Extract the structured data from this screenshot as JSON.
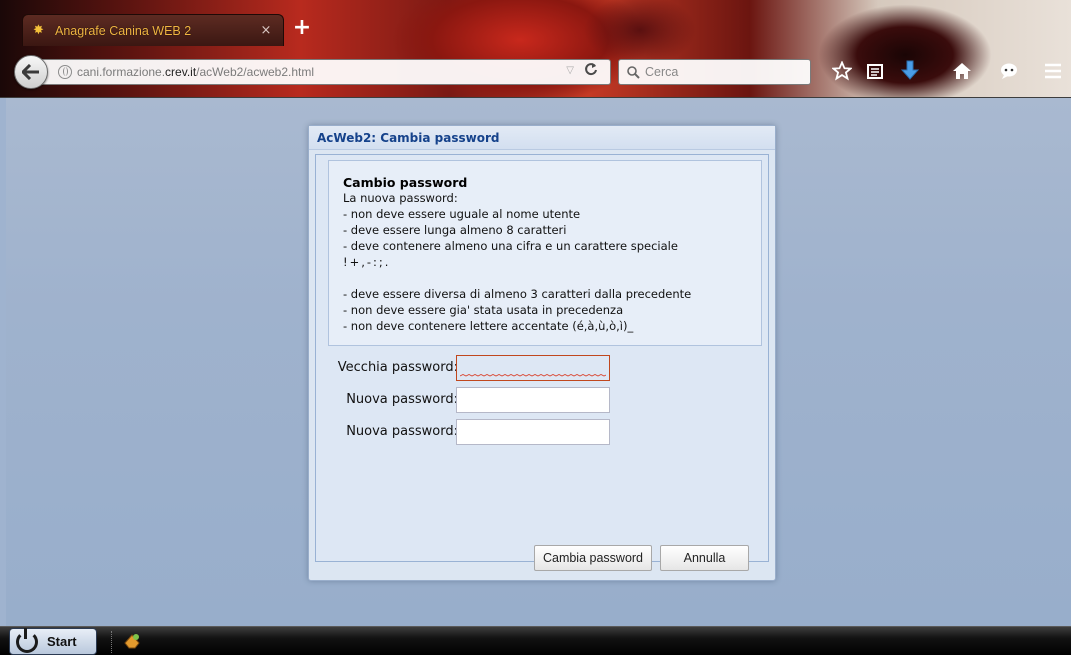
{
  "browser": {
    "tab": {
      "title": "Anagrafe Canina WEB 2",
      "close_glyph": "×"
    },
    "new_tab_glyph": "+",
    "url": {
      "prefix": "cani.formazione.",
      "domain": "crev.it",
      "path": "/acWeb2/acweb2.html"
    },
    "search": {
      "placeholder": "Cerca"
    },
    "icons": [
      "back-icon",
      "site-identity-icon",
      "reload-icon",
      "search-icon",
      "bookmark-star-icon",
      "reading-list-icon",
      "download-icon",
      "home-icon",
      "chat-icon",
      "menu-icon"
    ]
  },
  "dialog": {
    "title": "AcWeb2: Cambia password",
    "info": {
      "heading": "Cambio password",
      "lines": [
        "La nuova password:",
        "- non deve essere uguale al nome utente",
        "- deve essere lunga almeno 8 caratteri",
        "- deve contenere almeno una cifra e un carattere speciale",
        "!+,-:;.",
        "",
        "- deve essere diversa di almeno 3 caratteri dalla precedente",
        "- non deve essere gia' stata usata in precedenza",
        "- non deve contenere lettere accentate (é,à,ù,ò,ì)_"
      ]
    },
    "fields": [
      {
        "label": "Vecchia password:",
        "value": "",
        "invalid": true
      },
      {
        "label": "Nuova password:",
        "value": "",
        "invalid": false
      },
      {
        "label": "Nuova password:",
        "value": "",
        "invalid": false
      }
    ],
    "buttons": {
      "confirm": "Cambia password",
      "cancel": "Annulla"
    }
  },
  "taskbar": {
    "start_label": "Start"
  },
  "colors": {
    "dialog_title": "#15428b",
    "invalid_border": "#c0471d",
    "page_bg": "#9fb3cf"
  }
}
